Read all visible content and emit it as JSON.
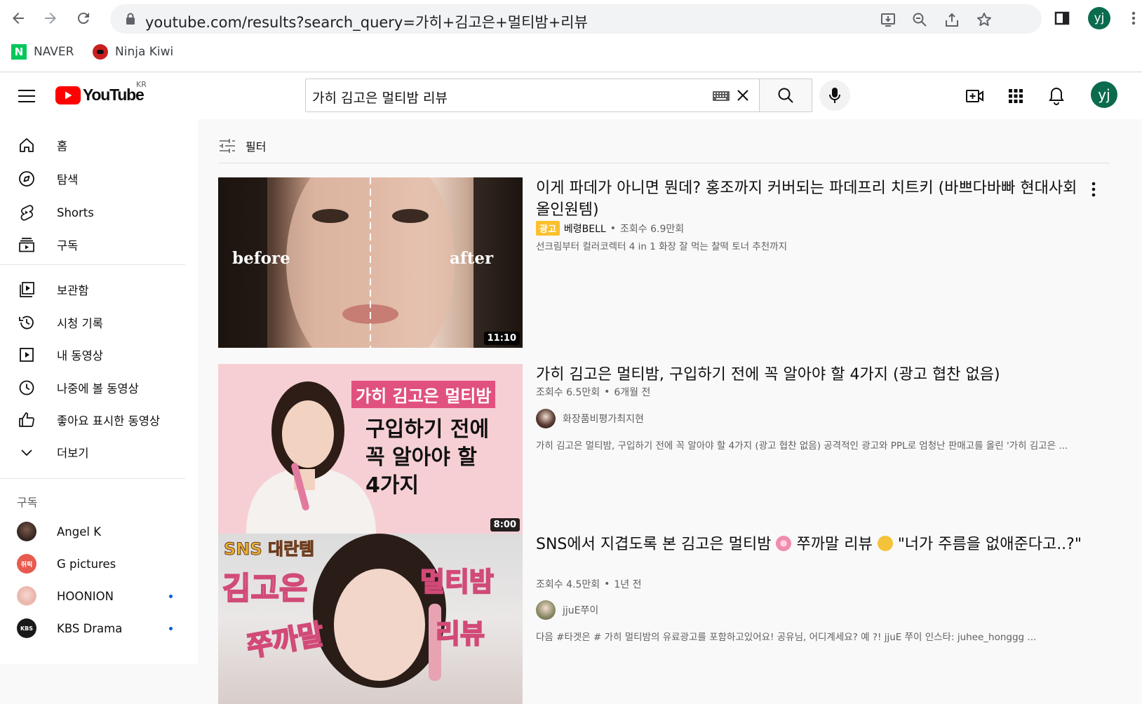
{
  "browser": {
    "url_text": "youtube.com/results?search_query=가히+김고은+멀티밤+리뷰",
    "profile_initials": "yj",
    "bookmarks": [
      {
        "label": "NAVER"
      },
      {
        "label": "Ninja Kiwi"
      }
    ]
  },
  "header": {
    "logo_text": "YouTube",
    "region": "KR",
    "search_query": "가히 김고은 멀티밤 리뷰",
    "avatar_initials": "yj"
  },
  "sidebar": {
    "main_items": [
      {
        "label": "홈"
      },
      {
        "label": "탐색"
      },
      {
        "label": "Shorts"
      },
      {
        "label": "구독"
      }
    ],
    "library_items": [
      {
        "label": "보관함"
      },
      {
        "label": "시청 기록"
      },
      {
        "label": "내 동영상"
      },
      {
        "label": "나중에 볼 동영상"
      },
      {
        "label": "좋아요 표시한 동영상"
      },
      {
        "label": "더보기"
      }
    ],
    "subs_heading": "구독",
    "subscriptions": [
      {
        "name": "Angel K",
        "new": false,
        "color": "#3a2a24"
      },
      {
        "name": "G pictures",
        "new": false,
        "color": "#e85a4f",
        "badge": "쥐픽"
      },
      {
        "name": "HOONION",
        "new": true,
        "color": "#f0c7c0"
      },
      {
        "name": "KBS Drama",
        "new": true,
        "color": "#1a1a1a",
        "badge": "KBS"
      }
    ]
  },
  "filter": {
    "label": "필터"
  },
  "results": [
    {
      "title": "이게 파데가 아니면 뭔데? 홍조까지 커버되는 파데프리 치트키 (바쁘다바빠 현대사회 올인원템)",
      "ad_label": "광고",
      "channel": "베령BELL",
      "views": "조회수 6.9만회",
      "description": "선크림부터 컬러코렉터 4 in 1 화장 잘 먹는 찰떡 토너 추천까지",
      "duration": "11:10",
      "thumb_before": "before",
      "thumb_after": "after"
    },
    {
      "title": "가히 김고은 멀티밤, 구입하기 전에 꼭 알아야 할 4가지 (광고 협찬 없음)",
      "views": "조회수 6.5만회",
      "age": "6개월 전",
      "channel": "화장품비평가최지현",
      "description": "가히 김고은 멀티밤, 구입하기 전에 꼭 알아야 할 4가지 (광고 협찬 없음) 공격적인 광고와 PPL로 엄청난 판매고를 올린 '가히 김고은 ...",
      "duration": "8:00",
      "thumb_tag": "가히 김고은 멀티밤",
      "thumb_lines": [
        "구입하기 전에",
        "꼭 알아야 할",
        "4가지"
      ]
    },
    {
      "title_part1": "SNS에서 지겹도록 본 김고은 멀티밤",
      "title_part2": "쭈까말 리뷰",
      "title_part3": "\"너가 주름을 없애준다고..?\"",
      "views": "조회수 4.5만회",
      "age": "1년 전",
      "channel": "jjuE쭈이",
      "description": "다음 #타겟은 # 가히 멀티밤의 유료광고를 포함하고있어요! 공유님, 어디계세요? 예 ?! jjuE 쭈이 인스타: juhee_honggg ...",
      "thumb_sns": "SNS 대란템",
      "thumb_left": "김고은",
      "thumb_right": "멀티밤",
      "thumb_bottom_left": "쭈까말",
      "thumb_bottom_right": "리뷰"
    }
  ],
  "colors": {
    "youtube_red": "#ff0000",
    "ad_yellow": "#fbc02d",
    "avatar_green": "#0b6b4f",
    "naver_green": "#03c75a"
  }
}
